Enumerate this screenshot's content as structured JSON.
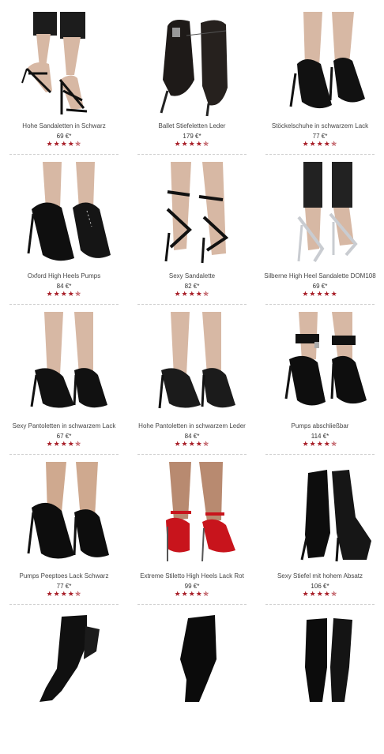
{
  "products": [
    {
      "name": "Hohe Sandaletten in Schwarz",
      "price": "69 €*",
      "rating": "★★★★✯"
    },
    {
      "name": "Ballet Stiefeletten Leder",
      "price": "179 €*",
      "rating": "★★★★✯"
    },
    {
      "name": "Stöckelschuhe in schwarzem Lack",
      "price": "77 €*",
      "rating": "★★★★✯"
    },
    {
      "name": "Oxford High Heels Pumps",
      "price": "84 €*",
      "rating": "★★★★✯"
    },
    {
      "name": "Sexy Sandalette",
      "price": "82 €*",
      "rating": "★★★★✯"
    },
    {
      "name": "Silberne High Heel Sandalette DOM108",
      "price": "69 €*",
      "rating": "★★★★★"
    },
    {
      "name": "Sexy Pantoletten in schwarzem Lack",
      "price": "67 €*",
      "rating": "★★★★✯"
    },
    {
      "name": "Hohe Pantoletten in schwarzem Leder",
      "price": "84 €*",
      "rating": "★★★★✯"
    },
    {
      "name": "Pumps abschließbar",
      "price": "114 €*",
      "rating": "★★★★✯"
    },
    {
      "name": "Pumps Peeptoes Lack Schwarz",
      "price": "77 €*",
      "rating": "★★★★✯"
    },
    {
      "name": "Extreme Stiletto High Heels Lack Rot",
      "price": "99 €*",
      "rating": "★★★★✯"
    },
    {
      "name": "Sexy Stiefel mit hohem Absatz",
      "price": "106 €*",
      "rating": "★★★★✯"
    }
  ],
  "images": [
    "sandal-black-image",
    "ballet-boot-image",
    "pump-black-image",
    "oxford-pump-image",
    "strap-sandal-image",
    "silver-sandal-image",
    "mule-black-image",
    "mule-leather-image",
    "locking-pump-image",
    "peeptoe-pump-image",
    "red-stiletto-image",
    "knee-boot-image",
    "thigh-boot-image",
    "thigh-boot-image",
    "thigh-boot-image"
  ],
  "colors": {
    "star": "#a8202a",
    "skin": "#d7b8a4",
    "shoe": "#1a1a1a",
    "red": "#c8141c",
    "silver": "#c9ccd1"
  }
}
